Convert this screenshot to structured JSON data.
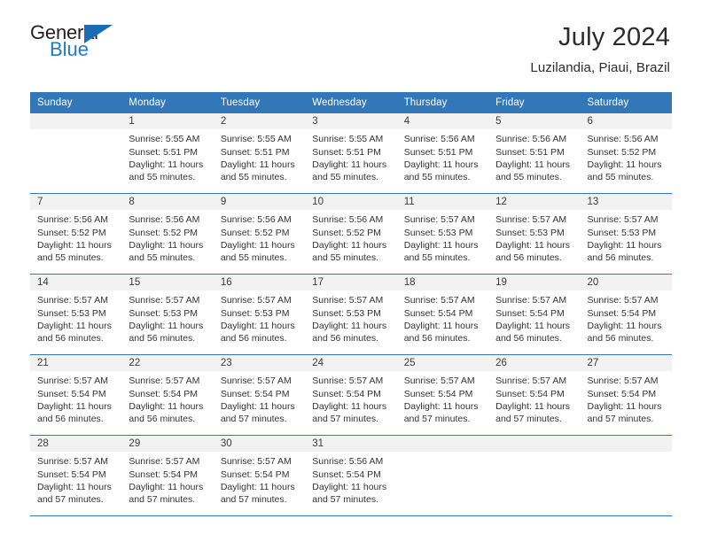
{
  "brand": {
    "name_part1": "General",
    "name_part2": "Blue"
  },
  "header": {
    "title": "July 2024",
    "subtitle": "Luzilandia, Piaui, Brazil"
  },
  "calendar": {
    "weekdays": [
      "Sunday",
      "Monday",
      "Tuesday",
      "Wednesday",
      "Thursday",
      "Friday",
      "Saturday"
    ],
    "accent_color": "#3277b8",
    "daynum_band_color": "#f2f2f2",
    "weeks": [
      [
        {
          "day": "",
          "sunrise": "",
          "sunset": "",
          "daylight1": "",
          "daylight2": ""
        },
        {
          "day": "1",
          "sunrise": "Sunrise: 5:55 AM",
          "sunset": "Sunset: 5:51 PM",
          "daylight1": "Daylight: 11 hours",
          "daylight2": "and 55 minutes."
        },
        {
          "day": "2",
          "sunrise": "Sunrise: 5:55 AM",
          "sunset": "Sunset: 5:51 PM",
          "daylight1": "Daylight: 11 hours",
          "daylight2": "and 55 minutes."
        },
        {
          "day": "3",
          "sunrise": "Sunrise: 5:55 AM",
          "sunset": "Sunset: 5:51 PM",
          "daylight1": "Daylight: 11 hours",
          "daylight2": "and 55 minutes."
        },
        {
          "day": "4",
          "sunrise": "Sunrise: 5:56 AM",
          "sunset": "Sunset: 5:51 PM",
          "daylight1": "Daylight: 11 hours",
          "daylight2": "and 55 minutes."
        },
        {
          "day": "5",
          "sunrise": "Sunrise: 5:56 AM",
          "sunset": "Sunset: 5:51 PM",
          "daylight1": "Daylight: 11 hours",
          "daylight2": "and 55 minutes."
        },
        {
          "day": "6",
          "sunrise": "Sunrise: 5:56 AM",
          "sunset": "Sunset: 5:52 PM",
          "daylight1": "Daylight: 11 hours",
          "daylight2": "and 55 minutes."
        }
      ],
      [
        {
          "day": "7",
          "sunrise": "Sunrise: 5:56 AM",
          "sunset": "Sunset: 5:52 PM",
          "daylight1": "Daylight: 11 hours",
          "daylight2": "and 55 minutes."
        },
        {
          "day": "8",
          "sunrise": "Sunrise: 5:56 AM",
          "sunset": "Sunset: 5:52 PM",
          "daylight1": "Daylight: 11 hours",
          "daylight2": "and 55 minutes."
        },
        {
          "day": "9",
          "sunrise": "Sunrise: 5:56 AM",
          "sunset": "Sunset: 5:52 PM",
          "daylight1": "Daylight: 11 hours",
          "daylight2": "and 55 minutes."
        },
        {
          "day": "10",
          "sunrise": "Sunrise: 5:56 AM",
          "sunset": "Sunset: 5:52 PM",
          "daylight1": "Daylight: 11 hours",
          "daylight2": "and 55 minutes."
        },
        {
          "day": "11",
          "sunrise": "Sunrise: 5:57 AM",
          "sunset": "Sunset: 5:53 PM",
          "daylight1": "Daylight: 11 hours",
          "daylight2": "and 55 minutes."
        },
        {
          "day": "12",
          "sunrise": "Sunrise: 5:57 AM",
          "sunset": "Sunset: 5:53 PM",
          "daylight1": "Daylight: 11 hours",
          "daylight2": "and 56 minutes."
        },
        {
          "day": "13",
          "sunrise": "Sunrise: 5:57 AM",
          "sunset": "Sunset: 5:53 PM",
          "daylight1": "Daylight: 11 hours",
          "daylight2": "and 56 minutes."
        }
      ],
      [
        {
          "day": "14",
          "sunrise": "Sunrise: 5:57 AM",
          "sunset": "Sunset: 5:53 PM",
          "daylight1": "Daylight: 11 hours",
          "daylight2": "and 56 minutes."
        },
        {
          "day": "15",
          "sunrise": "Sunrise: 5:57 AM",
          "sunset": "Sunset: 5:53 PM",
          "daylight1": "Daylight: 11 hours",
          "daylight2": "and 56 minutes."
        },
        {
          "day": "16",
          "sunrise": "Sunrise: 5:57 AM",
          "sunset": "Sunset: 5:53 PM",
          "daylight1": "Daylight: 11 hours",
          "daylight2": "and 56 minutes."
        },
        {
          "day": "17",
          "sunrise": "Sunrise: 5:57 AM",
          "sunset": "Sunset: 5:53 PM",
          "daylight1": "Daylight: 11 hours",
          "daylight2": "and 56 minutes."
        },
        {
          "day": "18",
          "sunrise": "Sunrise: 5:57 AM",
          "sunset": "Sunset: 5:54 PM",
          "daylight1": "Daylight: 11 hours",
          "daylight2": "and 56 minutes."
        },
        {
          "day": "19",
          "sunrise": "Sunrise: 5:57 AM",
          "sunset": "Sunset: 5:54 PM",
          "daylight1": "Daylight: 11 hours",
          "daylight2": "and 56 minutes."
        },
        {
          "day": "20",
          "sunrise": "Sunrise: 5:57 AM",
          "sunset": "Sunset: 5:54 PM",
          "daylight1": "Daylight: 11 hours",
          "daylight2": "and 56 minutes."
        }
      ],
      [
        {
          "day": "21",
          "sunrise": "Sunrise: 5:57 AM",
          "sunset": "Sunset: 5:54 PM",
          "daylight1": "Daylight: 11 hours",
          "daylight2": "and 56 minutes."
        },
        {
          "day": "22",
          "sunrise": "Sunrise: 5:57 AM",
          "sunset": "Sunset: 5:54 PM",
          "daylight1": "Daylight: 11 hours",
          "daylight2": "and 56 minutes."
        },
        {
          "day": "23",
          "sunrise": "Sunrise: 5:57 AM",
          "sunset": "Sunset: 5:54 PM",
          "daylight1": "Daylight: 11 hours",
          "daylight2": "and 57 minutes."
        },
        {
          "day": "24",
          "sunrise": "Sunrise: 5:57 AM",
          "sunset": "Sunset: 5:54 PM",
          "daylight1": "Daylight: 11 hours",
          "daylight2": "and 57 minutes."
        },
        {
          "day": "25",
          "sunrise": "Sunrise: 5:57 AM",
          "sunset": "Sunset: 5:54 PM",
          "daylight1": "Daylight: 11 hours",
          "daylight2": "and 57 minutes."
        },
        {
          "day": "26",
          "sunrise": "Sunrise: 5:57 AM",
          "sunset": "Sunset: 5:54 PM",
          "daylight1": "Daylight: 11 hours",
          "daylight2": "and 57 minutes."
        },
        {
          "day": "27",
          "sunrise": "Sunrise: 5:57 AM",
          "sunset": "Sunset: 5:54 PM",
          "daylight1": "Daylight: 11 hours",
          "daylight2": "and 57 minutes."
        }
      ],
      [
        {
          "day": "28",
          "sunrise": "Sunrise: 5:57 AM",
          "sunset": "Sunset: 5:54 PM",
          "daylight1": "Daylight: 11 hours",
          "daylight2": "and 57 minutes."
        },
        {
          "day": "29",
          "sunrise": "Sunrise: 5:57 AM",
          "sunset": "Sunset: 5:54 PM",
          "daylight1": "Daylight: 11 hours",
          "daylight2": "and 57 minutes."
        },
        {
          "day": "30",
          "sunrise": "Sunrise: 5:57 AM",
          "sunset": "Sunset: 5:54 PM",
          "daylight1": "Daylight: 11 hours",
          "daylight2": "and 57 minutes."
        },
        {
          "day": "31",
          "sunrise": "Sunrise: 5:56 AM",
          "sunset": "Sunset: 5:54 PM",
          "daylight1": "Daylight: 11 hours",
          "daylight2": "and 57 minutes."
        },
        {
          "day": "",
          "sunrise": "",
          "sunset": "",
          "daylight1": "",
          "daylight2": ""
        },
        {
          "day": "",
          "sunrise": "",
          "sunset": "",
          "daylight1": "",
          "daylight2": ""
        },
        {
          "day": "",
          "sunrise": "",
          "sunset": "",
          "daylight1": "",
          "daylight2": ""
        }
      ]
    ]
  }
}
